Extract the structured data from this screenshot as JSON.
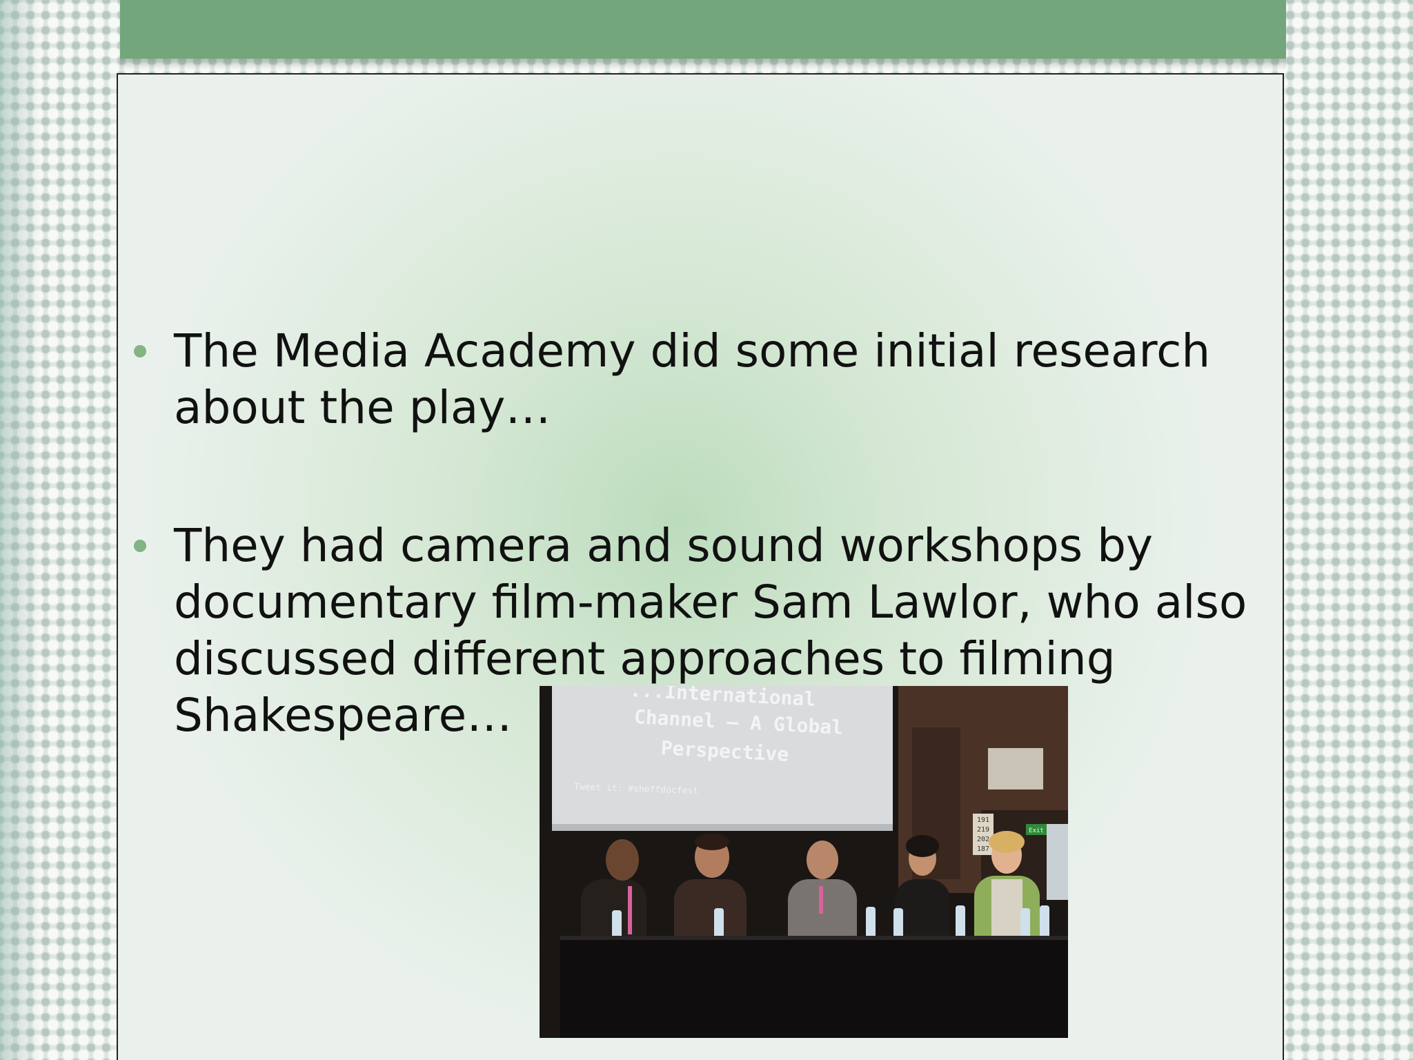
{
  "slide": {
    "accent_color": "#73a67b",
    "bullet_color": "#82b486",
    "bullets": [
      {
        "text": "The Media Academy did some initial research about the play…"
      },
      {
        "text": "They had camera and sound workshops by documentary film-maker Sam Lawlor, who also discussed different approaches to filming Shakespeare…"
      }
    ]
  },
  "photo": {
    "screen_lines": [
      "...International",
      "Channel – A Global",
      "Perspective"
    ],
    "screen_tweet": "Tweet it: #sheffdocfest",
    "wall_sign": "Exit",
    "seat_numbers": [
      "191",
      "219",
      "202",
      "187"
    ]
  }
}
